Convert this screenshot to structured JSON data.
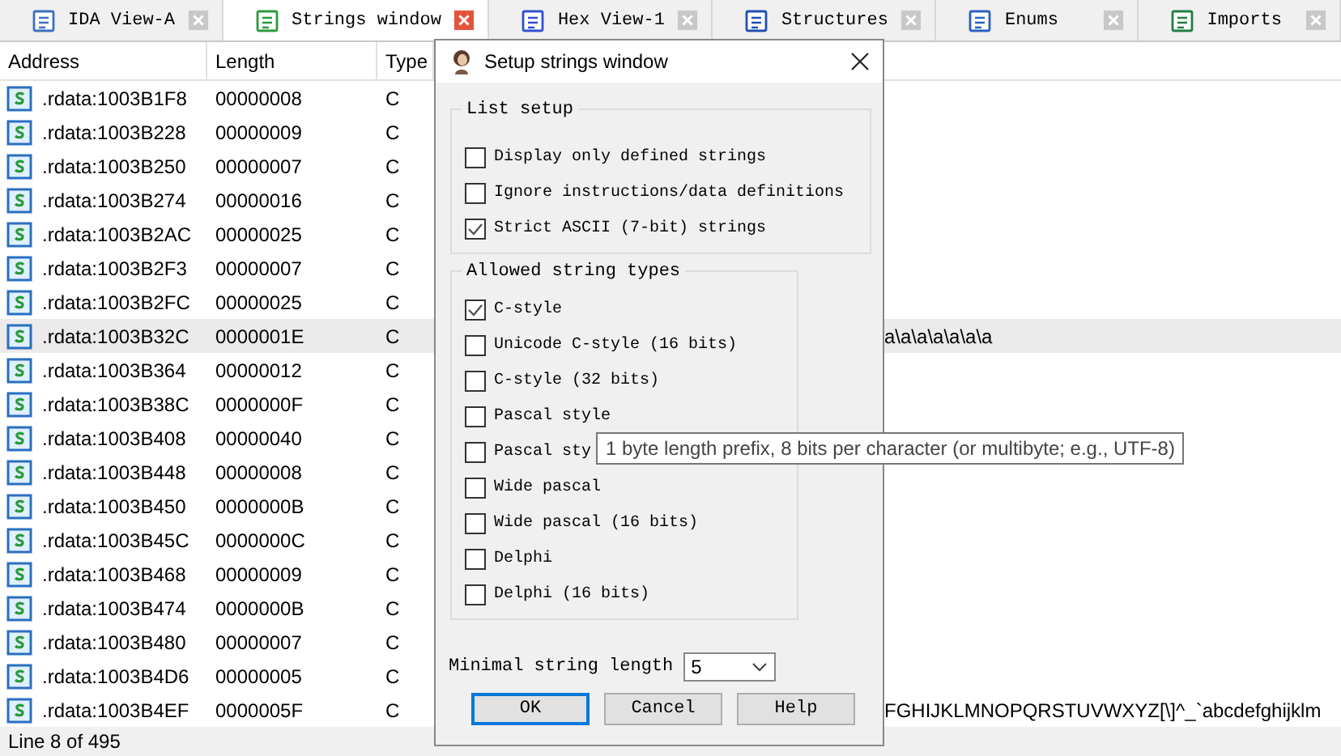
{
  "tabs": [
    {
      "label": "IDA View-A",
      "selected": false
    },
    {
      "label": "Strings window",
      "selected": true
    },
    {
      "label": "Hex View-1",
      "selected": false
    },
    {
      "label": "Structures",
      "selected": false
    },
    {
      "label": "Enums",
      "selected": false
    },
    {
      "label": "Imports",
      "selected": false
    }
  ],
  "table": {
    "columns": [
      "Address",
      "Length",
      "Type"
    ],
    "rows": [
      {
        "address": ".rdata:1003B1F8",
        "length": "00000008",
        "type": "C",
        "selected": false
      },
      {
        "address": ".rdata:1003B228",
        "length": "00000009",
        "type": "C",
        "selected": false
      },
      {
        "address": ".rdata:1003B250",
        "length": "00000007",
        "type": "C",
        "selected": false
      },
      {
        "address": ".rdata:1003B274",
        "length": "00000016",
        "type": "C",
        "selected": false
      },
      {
        "address": ".rdata:1003B2AC",
        "length": "00000025",
        "type": "C",
        "selected": false
      },
      {
        "address": ".rdata:1003B2F3",
        "length": "00000007",
        "type": "C",
        "selected": false
      },
      {
        "address": ".rdata:1003B2FC",
        "length": "00000025",
        "type": "C",
        "selected": false
      },
      {
        "address": ".rdata:1003B32C",
        "length": "0000001E",
        "type": "C",
        "selected": true,
        "column_4": "a\\a\\a\\a\\a\\a\\a"
      },
      {
        "address": ".rdata:1003B364",
        "length": "00000012",
        "type": "C",
        "selected": false
      },
      {
        "address": ".rdata:1003B38C",
        "length": "0000000F",
        "type": "C",
        "selected": false
      },
      {
        "address": ".rdata:1003B408",
        "length": "00000040",
        "type": "C",
        "selected": false
      },
      {
        "address": ".rdata:1003B448",
        "length": "00000008",
        "type": "C",
        "selected": false
      },
      {
        "address": ".rdata:1003B450",
        "length": "0000000B",
        "type": "C",
        "selected": false
      },
      {
        "address": ".rdata:1003B45C",
        "length": "0000000C",
        "type": "C",
        "selected": false
      },
      {
        "address": ".rdata:1003B468",
        "length": "00000009",
        "type": "C",
        "selected": false
      },
      {
        "address": ".rdata:1003B474",
        "length": "0000000B",
        "type": "C",
        "selected": false
      },
      {
        "address": ".rdata:1003B480",
        "length": "00000007",
        "type": "C",
        "selected": false
      },
      {
        "address": ".rdata:1003B4D6",
        "length": "00000005",
        "type": "C",
        "selected": false
      },
      {
        "address": ".rdata:1003B4EF",
        "length": "0000005F",
        "type": "C",
        "selected": false,
        "column_4": "FGHIJKLMNOPQRSTUVWXYZ[\\]^_`abcdefghijklm"
      }
    ]
  },
  "status_bar": "Line 8 of 495",
  "dialog": {
    "title": "Setup strings window",
    "list_setup": {
      "title": "List setup",
      "options": [
        {
          "label": "Display only defined strings",
          "checked": false
        },
        {
          "label": "Ignore instructions/data definitions",
          "checked": false
        },
        {
          "label": "Strict ASCII (7-bit) strings",
          "checked": true
        }
      ]
    },
    "string_types": {
      "title": "Allowed string types",
      "options": [
        {
          "label": "C-style",
          "checked": true
        },
        {
          "label": "Unicode C-style (16 bits)",
          "checked": false
        },
        {
          "label": "C-style (32 bits)",
          "checked": false
        },
        {
          "label": "Pascal style",
          "checked": false
        },
        {
          "label": "Pascal sty",
          "checked": false
        },
        {
          "label": "Wide pascal",
          "checked": false
        },
        {
          "label": "Wide pascal (16 bits)",
          "checked": false
        },
        {
          "label": "Delphi",
          "checked": false
        },
        {
          "label": "Delphi (16 bits)",
          "checked": false
        }
      ]
    },
    "min_length": {
      "label": "Minimal string length",
      "value": "5"
    },
    "buttons": [
      {
        "label": "OK",
        "default": true
      },
      {
        "label": "Cancel",
        "default": false
      },
      {
        "label": "Help",
        "default": false
      }
    ]
  },
  "tooltip": "1 byte length prefix, 8 bits per character (or multibyte; e.g., UTF-8)"
}
